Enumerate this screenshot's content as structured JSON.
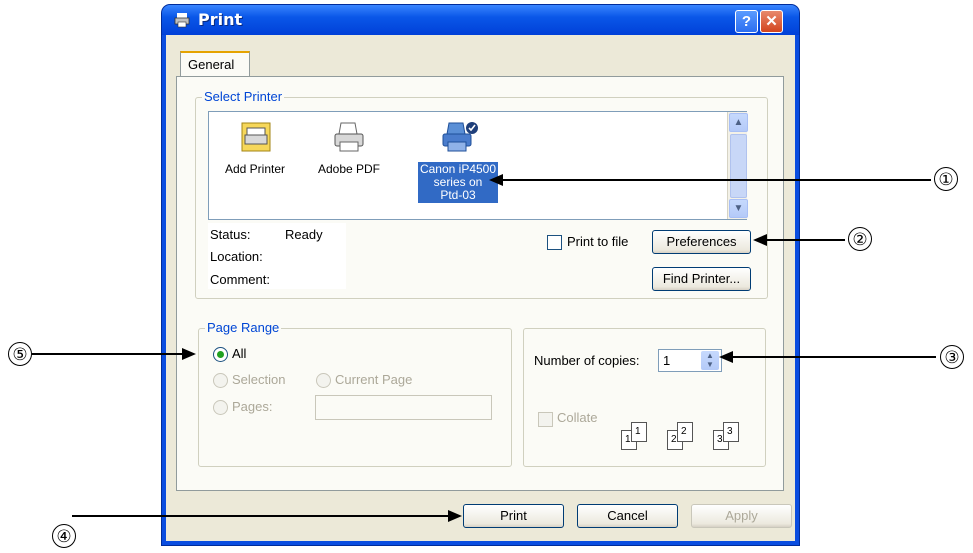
{
  "window": {
    "title": "Print",
    "help_label": "?",
    "close_label": "✕"
  },
  "tabs": [
    {
      "label": "General"
    }
  ],
  "select_printer": {
    "legend": "Select Printer",
    "printers": [
      {
        "label": "Add Printer",
        "icon": "add-printer-icon"
      },
      {
        "label": "Adobe PDF",
        "icon": "printer-icon"
      },
      {
        "label_line1": "Canon iP4500",
        "label_line2": "series on",
        "label_line3": "Ptd-03",
        "icon": "default-printer-icon",
        "selected": true
      }
    ],
    "status_label": "Status:",
    "status_value": "Ready",
    "location_label": "Location:",
    "comment_label": "Comment:",
    "print_to_file_label": "Print to file",
    "preferences_label": "Preferences",
    "find_printer_label": "Find Printer..."
  },
  "page_range": {
    "legend": "Page Range",
    "all_label": "All",
    "selection_label": "Selection",
    "current_page_label": "Current Page",
    "pages_label": "Pages:"
  },
  "copies": {
    "number_label": "Number of copies:",
    "number_value": "1",
    "collate_label": "Collate",
    "collate_pages": [
      "1",
      "1",
      "2",
      "2",
      "3",
      "3"
    ]
  },
  "buttons": {
    "print_label": "Print",
    "cancel_label": "Cancel",
    "apply_label": "Apply"
  },
  "annotations": [
    "①",
    "②",
    "③",
    "④",
    "⑤"
  ],
  "colors": {
    "title_blue": "#0a4de0",
    "dialog_bg": "#ece9d8",
    "group_title": "#0046d5",
    "selection": "#316ac5"
  }
}
